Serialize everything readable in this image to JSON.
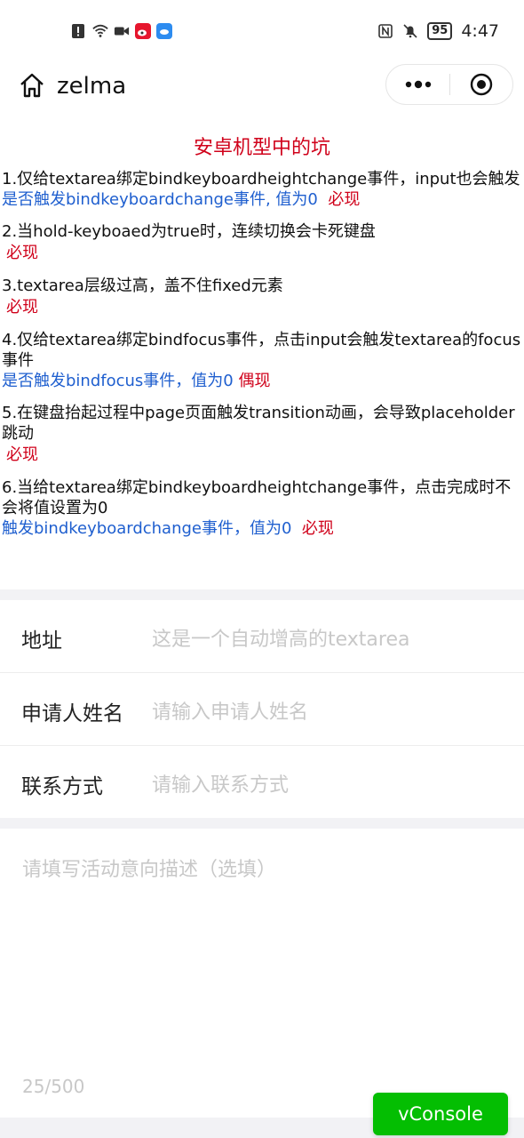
{
  "status_bar": {
    "time": "4:47",
    "battery": "95"
  },
  "nav": {
    "title": "zelma"
  },
  "notes": {
    "title": "安卓机型中的坑",
    "items": [
      {
        "q": "1.仅给textarea绑定bindkeyboardheightchange事件，input也会触发",
        "a": "是否触发bindkeyboardchange事件, 值为0",
        "flag": "必现"
      },
      {
        "q": "2.当hold-keyboaed为true时，连续切换会卡死键盘",
        "flag": "必现"
      },
      {
        "q": "3.textarea层级过高，盖不住fixed元素",
        "flag": "必现"
      },
      {
        "q": "4.仅给textarea绑定bindfocus事件，点击input会触发textarea的focus事件",
        "a": "是否触发bindfocus事件，值为0",
        "flag": "偶现"
      },
      {
        "q": "5.在键盘抬起过程中page页面触发transition动画，会导致placeholder跳动",
        "flag": "必现"
      },
      {
        "q": "6.当给textarea绑定bindkeyboardheightchange事件，点击完成时不会将值设置为0",
        "a": "触发bindkeyboardchange事件，值为0",
        "flag": "必现"
      }
    ]
  },
  "form": {
    "address_label": "地址",
    "address_placeholder": "这是一个自动增高的textarea",
    "name_label": "申请人姓名",
    "name_placeholder": "请输入申请人姓名",
    "contact_label": "联系方式",
    "contact_placeholder": "请输入联系方式",
    "desc_placeholder": "请填写活动意向描述（选填）",
    "desc_counter": "25/500"
  },
  "vconsole": {
    "label": "vConsole"
  },
  "colors": {
    "accent_red": "#d0021b",
    "accent_blue": "#1f5fcf",
    "vconsole_green": "#04be02"
  }
}
